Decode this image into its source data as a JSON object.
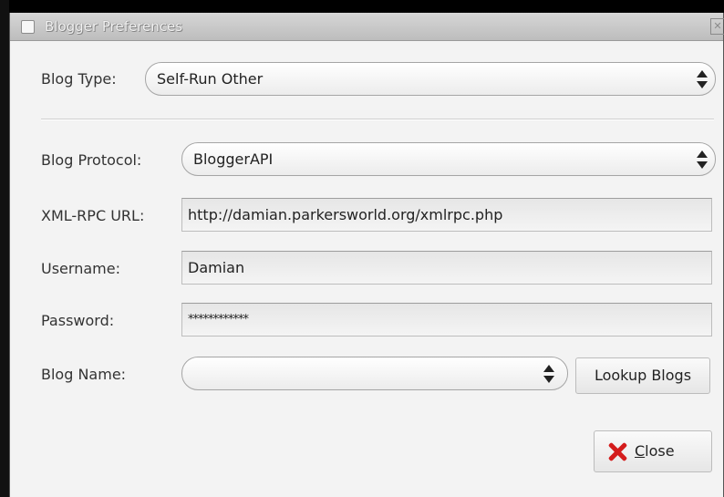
{
  "window": {
    "title": "Blogger Preferences",
    "close_glyph": "✕"
  },
  "blog_type": {
    "label": "Blog Type:",
    "value": "Self-Run Other"
  },
  "blog_protocol": {
    "label": "Blog Protocol:",
    "value": "BloggerAPI"
  },
  "xmlrpc_url": {
    "label": "XML-RPC URL:",
    "value": "http://damian.parkersworld.org/xmlrpc.php"
  },
  "username": {
    "label": "Username:",
    "value": "Damian"
  },
  "password": {
    "label": "Password:",
    "value": "************"
  },
  "blog_name": {
    "label": "Blog Name:",
    "value": ""
  },
  "lookup_button": {
    "label": "Lookup Blogs"
  },
  "close_button": {
    "label_mnemonic": "C",
    "label_rest": "lose",
    "icon": "close-icon"
  },
  "colors": {
    "close_icon": "#d41c1c",
    "window_bg": "#f3f3f3"
  }
}
